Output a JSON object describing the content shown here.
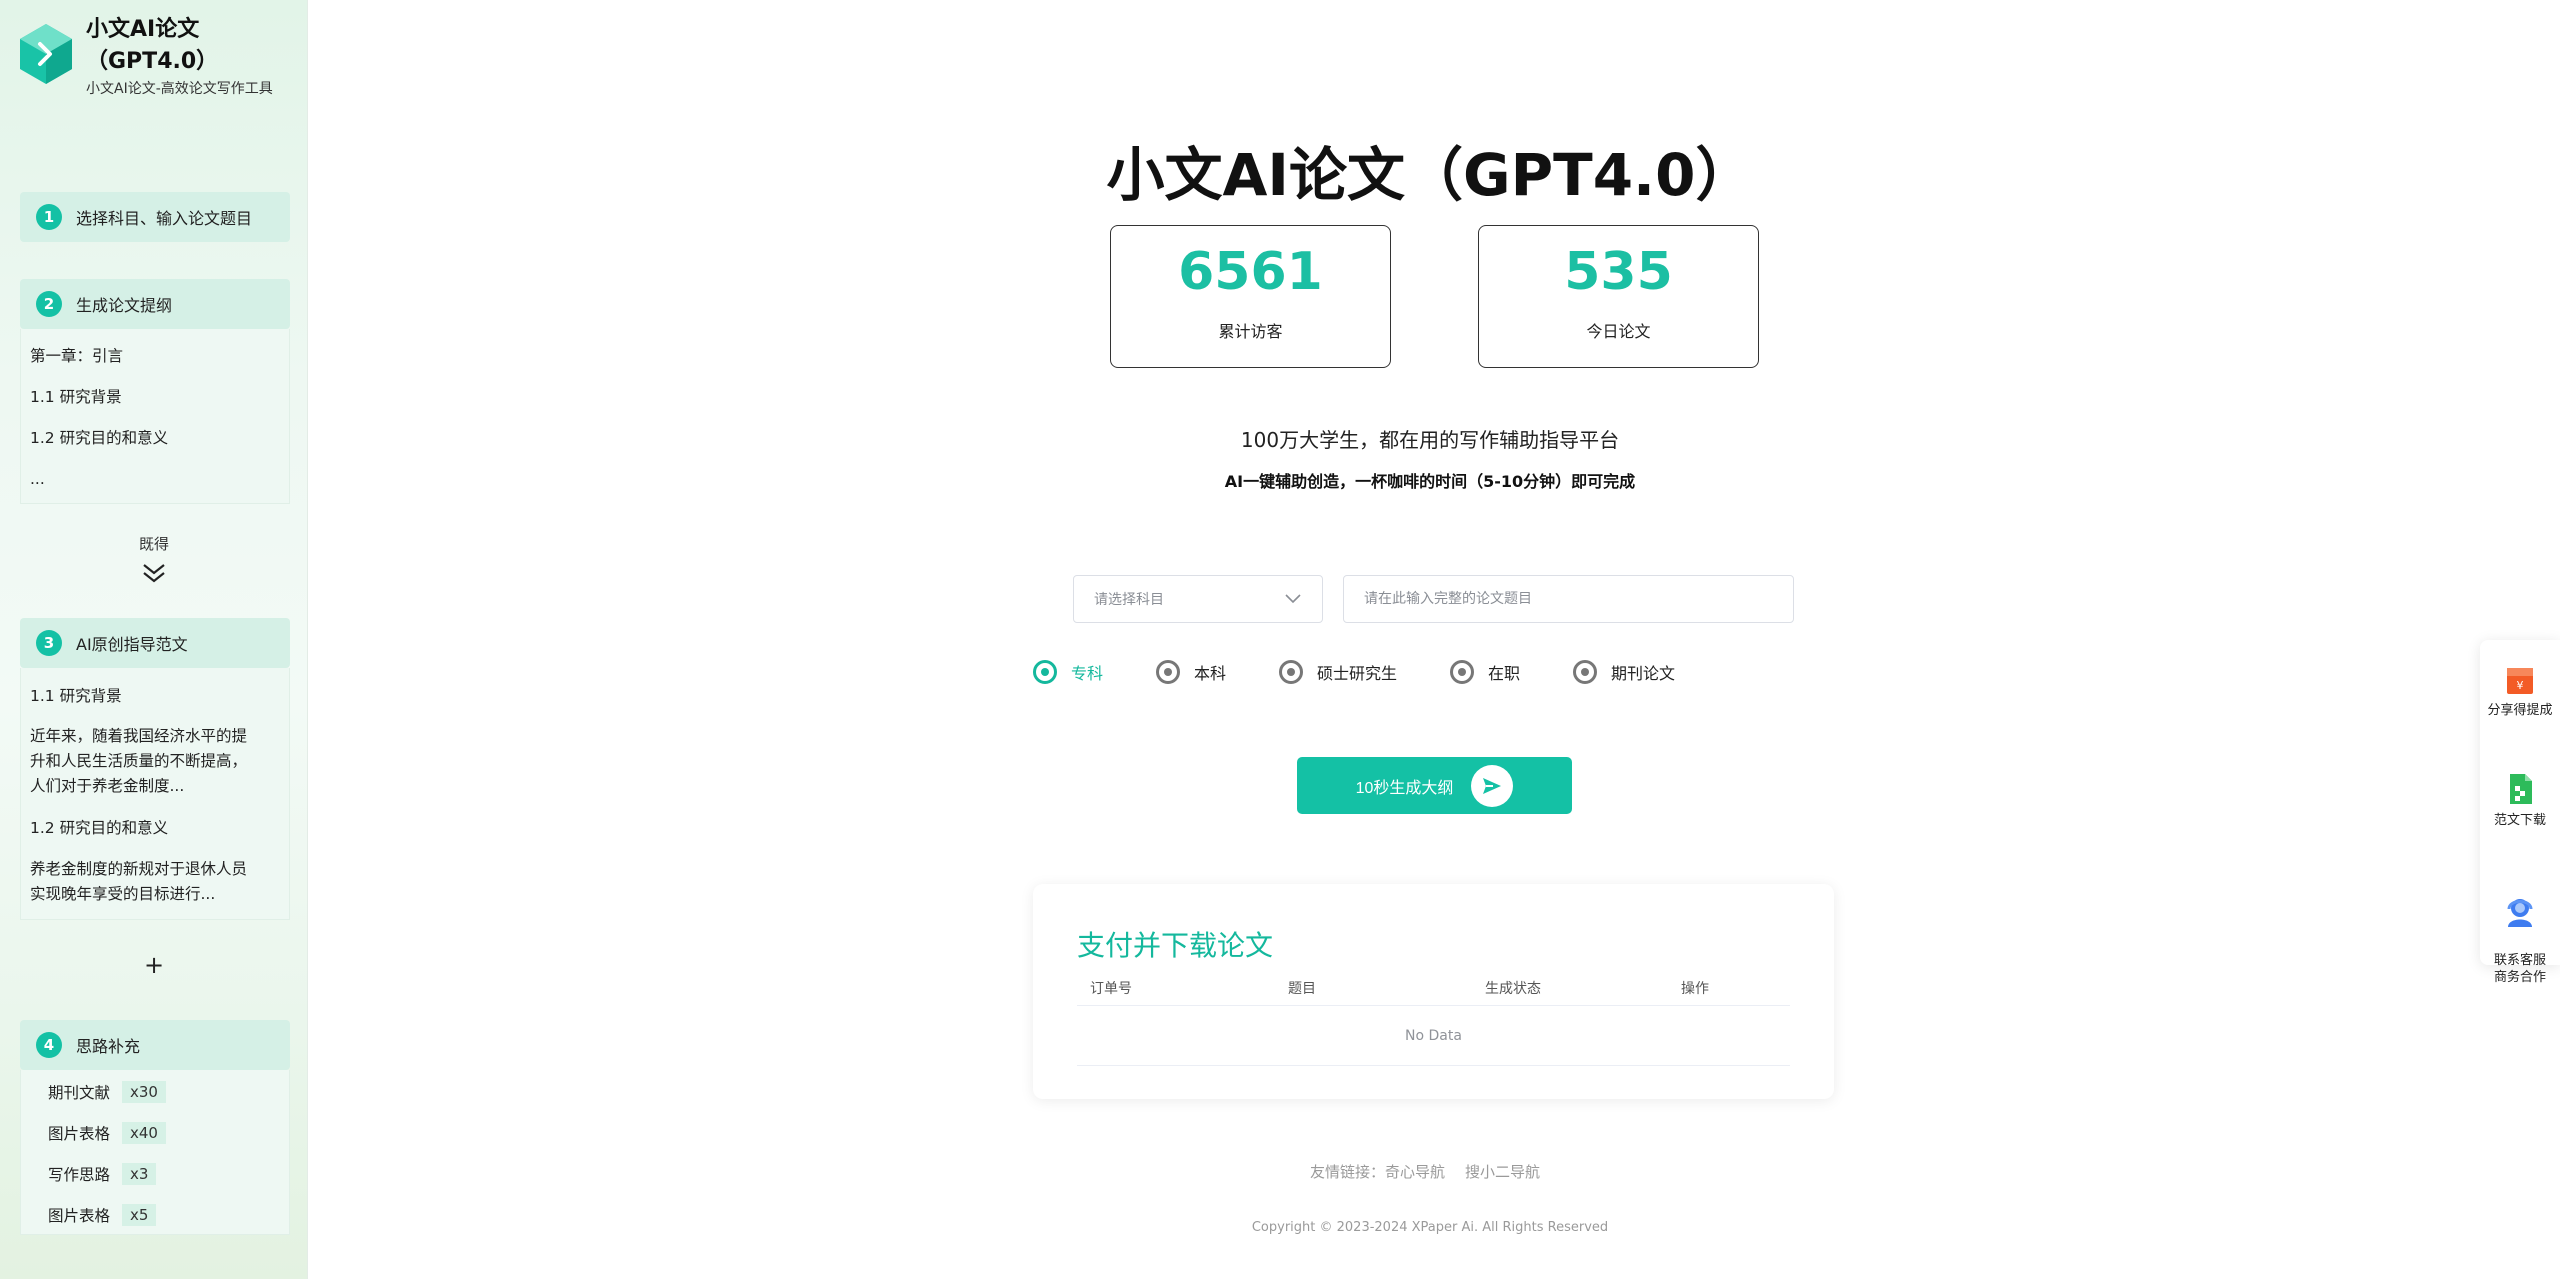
{
  "brand": {
    "title": "小文AI论文（GPT4.0）",
    "subtitle": "小文AI论文-高效论文写作工具"
  },
  "sidebar": {
    "step1": {
      "num": "1",
      "label": "选择科目、输入论文题目"
    },
    "step2": {
      "num": "2",
      "label": "生成论文提纲",
      "lines": [
        "第一章：引言",
        "1.1 研究背景",
        "1.2 研究目的和意义",
        "..."
      ]
    },
    "expand": {
      "label": "既得"
    },
    "step3": {
      "num": "3",
      "label": "AI原创指导范文",
      "lines": [
        "1.1 研究背景",
        "近年来，随着我国经济水平的提升和人民生活质量的不断提高，人们对于养老金制度...",
        "1.2 研究目的和意义",
        "养老金制度的新规对于退休人员实现晚年享受的目标进行..."
      ]
    },
    "add": {
      "symbol": "+"
    },
    "step4": {
      "num": "4",
      "label": "思路补充",
      "items": [
        {
          "label": "期刊文献",
          "badge": "x30"
        },
        {
          "label": "图片表格",
          "badge": "x40"
        },
        {
          "label": "写作思路",
          "badge": "x3"
        },
        {
          "label": "图片表格",
          "badge": "x5"
        }
      ]
    }
  },
  "main": {
    "title": "小文AI论文（GPT4.0）",
    "stats": [
      {
        "value": "6561",
        "label": "累计访客"
      },
      {
        "value": "535",
        "label": "今日论文"
      }
    ],
    "tagline": "100万大学生，都在用的写作辅助指导平台",
    "tagline2": "AI一键辅助创造，一杯咖啡的时间（5-10分钟）即可完成",
    "subject_select": {
      "placeholder": "请选择科目"
    },
    "topic_input": {
      "placeholder": "请在此输入完整的论文题目",
      "value": ""
    },
    "levels": [
      "专科",
      "本科",
      "硕士研究生",
      "在职",
      "期刊论文"
    ],
    "selected_level": "专科",
    "generate_button": "10秒生成大纲",
    "payment": {
      "title": "支付并下载论文",
      "columns": [
        "订单号",
        "题目",
        "生成状态",
        "操作"
      ],
      "empty_text": "No Data"
    },
    "friend_links": {
      "prefix": "友情链接：",
      "links": [
        "奇心导航",
        "搜小二导航"
      ]
    },
    "copyright": "Copyright © 2023-2024 XPaper Ai. All Rights Reserved"
  },
  "float_bar": [
    {
      "icon": "gift-icon",
      "label": "分享得提成"
    },
    {
      "icon": "document-download-icon",
      "label": "范文下载"
    },
    {
      "icon": "customer-service-icon",
      "label": "联系客服\n商务合作"
    }
  ],
  "colors": {
    "accent": "#14c1a5",
    "accent_text": "#14b89d",
    "step_head_bg": "#d5f0e6",
    "gift_orange": "#f35b26",
    "doc_green": "#2dbb5a",
    "service_blue": "#3e7cf0"
  }
}
